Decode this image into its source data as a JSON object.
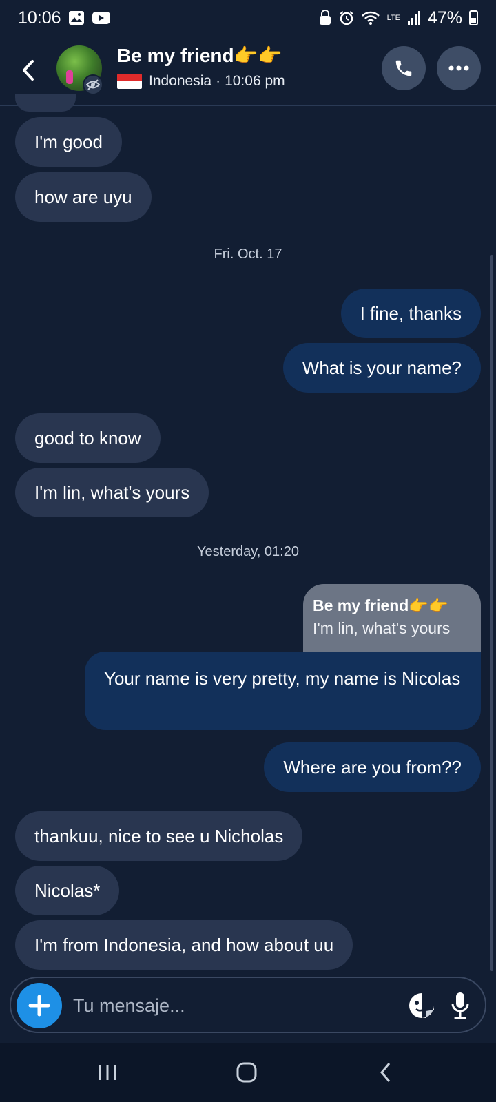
{
  "status_bar": {
    "time": "10:06",
    "battery": "47%",
    "network": "LTE"
  },
  "header": {
    "contact_name": "Be my friend👉👉",
    "country": "Indonesia",
    "separator": "·",
    "local_time": "10:06 pm"
  },
  "messages": {
    "in_1": "I'm good",
    "in_2": "how are uyu",
    "date_1": "Fri. Oct. 17",
    "out_1": "I fine, thanks",
    "out_2": "What is your name?",
    "in_3": "good to know",
    "in_4": "I'm lin, what's yours",
    "date_2": "Yesterday, 01:20",
    "reply_name": "Be my friend👉👉",
    "reply_text": "I'm lin, what's yours",
    "out_3": "Your name is very pretty, my name is Nicolas",
    "out_4": "Where are you from??",
    "in_5": "thankuu, nice to see u Nicholas",
    "in_6": "Nicolas*",
    "in_7": "I'm from Indonesia, and how about uu"
  },
  "composer": {
    "placeholder": "Tu mensaje..."
  },
  "colors": {
    "background": "#121e33",
    "incoming_bubble": "#293650",
    "outgoing_bubble": "#12305a",
    "accent": "#1e90e6"
  },
  "icons": {
    "back": "chevron-left-icon",
    "call": "phone-icon",
    "more": "more-horizontal-icon",
    "add": "plus-icon",
    "emoji": "sticker-icon",
    "mic": "microphone-icon"
  }
}
